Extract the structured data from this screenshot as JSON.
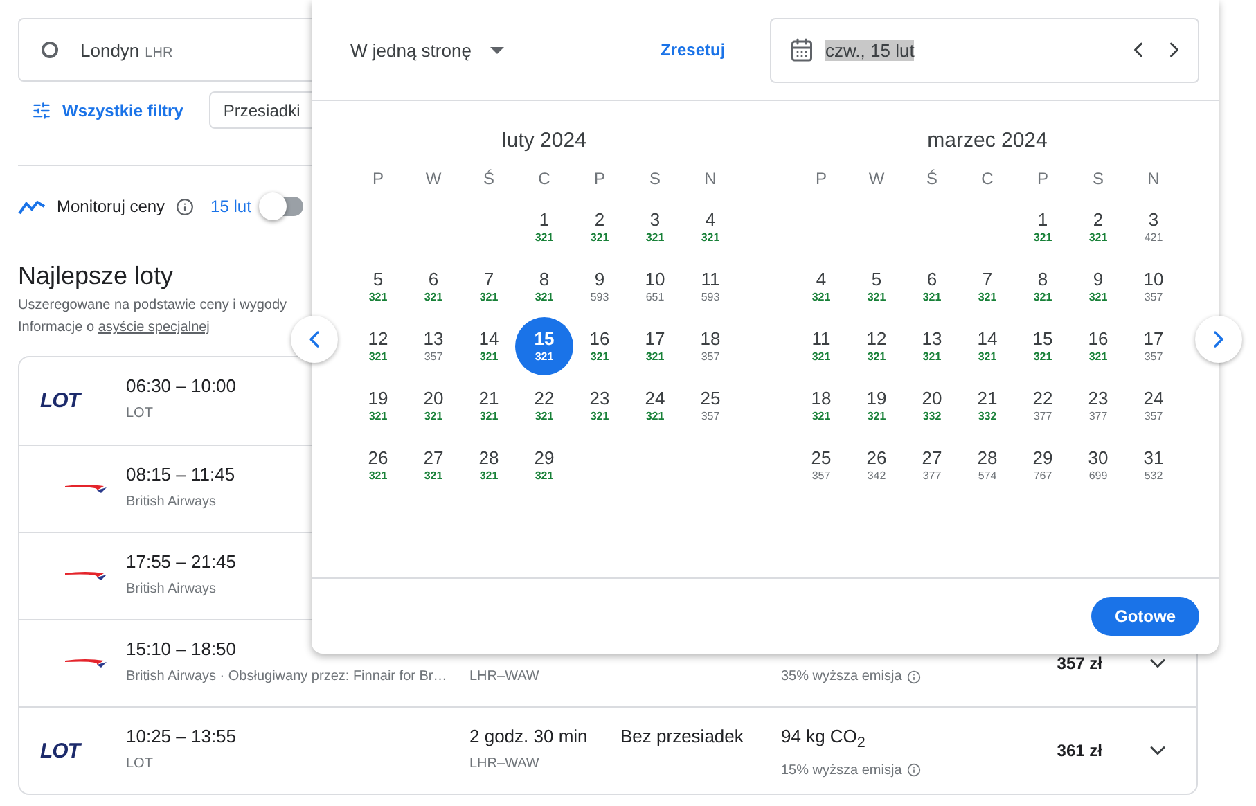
{
  "search": {
    "origin": {
      "city": "Londyn",
      "code": "LHR"
    }
  },
  "filters": {
    "all_filters": "Wszystkie filtry",
    "chips": [
      "Przesiadki"
    ]
  },
  "monitor": {
    "label": "Monitoruj ceny",
    "date": "15 lut",
    "on": false
  },
  "results": {
    "title": "Najlepsze loty",
    "subtitle": "Uszeregowane na podstawie ceny i wygody",
    "assist_prefix": "Informacje o ",
    "assist_link": "asyście specjalnej"
  },
  "flights": [
    {
      "logo": {
        "kind": "wordmark",
        "text": "LOT"
      },
      "times": "06:30 – 10:00",
      "airline": "LOT"
    },
    {
      "logo": {
        "kind": "ribbon"
      },
      "times": "08:15 – 11:45",
      "airline": "British Airways"
    },
    {
      "logo": {
        "kind": "ribbon"
      },
      "times": "17:55 – 21:45",
      "airline": "British Airways"
    },
    {
      "logo": {
        "kind": "ribbon"
      },
      "times": "15:10 – 18:50",
      "airline": "British Airways · Obsługiwany przez: Finnair for Br…",
      "route": "LHR–WAW",
      "emission_note": "35% wyższa emisja",
      "price": "357 zł",
      "expandable": true
    },
    {
      "logo": {
        "kind": "wordmark",
        "text": "LOT"
      },
      "times": "10:25 – 13:55",
      "airline": "LOT",
      "duration": "2 godz. 30 min",
      "route": "LHR–WAW",
      "stops": "Bez przesiadek",
      "emissions": "94 kg CO$_{2}$",
      "emission_note": "15% wyższa emisja",
      "price": "361 zł",
      "expandable": true
    }
  ],
  "date_picker": {
    "trip_type": "W jedną stronę",
    "reset": "Zresetuj",
    "date_value": "czw., 15 lut",
    "done": "Gotowe",
    "months": [
      {
        "title": "luty 2024",
        "weekdays": [
          "P",
          "W",
          "Ś",
          "C",
          "P",
          "S",
          "N"
        ],
        "weeks": [
          [
            {
              "d": "1",
              "price": "321",
              "low": true,
              "selected": false
            },
            {
              "d": "2",
              "price": "321",
              "low": true,
              "selected": false
            },
            {
              "d": "3",
              "price": "321",
              "low": true,
              "selected": false
            },
            {
              "d": "4",
              "price": "321",
              "low": true,
              "selected": false
            }
          ],
          [
            {
              "d": "5",
              "price": "321",
              "low": true,
              "selected": false
            },
            {
              "d": "6",
              "price": "321",
              "low": true,
              "selected": false
            },
            {
              "d": "7",
              "price": "321",
              "low": true,
              "selected": false
            },
            {
              "d": "8",
              "price": "321",
              "low": true,
              "selected": false
            },
            {
              "d": "9",
              "price": "593",
              "low": false,
              "selected": false
            },
            {
              "d": "10",
              "price": "651",
              "low": false,
              "selected": false
            },
            {
              "d": "11",
              "price": "593",
              "low": false,
              "selected": false
            }
          ],
          [
            {
              "d": "12",
              "price": "321",
              "low": true,
              "selected": false
            },
            {
              "d": "13",
              "price": "357",
              "low": false,
              "selected": false
            },
            {
              "d": "14",
              "price": "321",
              "low": true,
              "selected": false
            },
            {
              "d": "15",
              "price": "321",
              "low": true,
              "selected": true
            },
            {
              "d": "16",
              "price": "321",
              "low": true,
              "selected": false
            },
            {
              "d": "17",
              "price": "321",
              "low": true,
              "selected": false
            },
            {
              "d": "18",
              "price": "357",
              "low": false,
              "selected": false
            }
          ],
          [
            {
              "d": "19",
              "price": "321",
              "low": true,
              "selected": false
            },
            {
              "d": "20",
              "price": "321",
              "low": true,
              "selected": false
            },
            {
              "d": "21",
              "price": "321",
              "low": true,
              "selected": false
            },
            {
              "d": "22",
              "price": "321",
              "low": true,
              "selected": false
            },
            {
              "d": "23",
              "price": "321",
              "low": true,
              "selected": false
            },
            {
              "d": "24",
              "price": "321",
              "low": true,
              "selected": false
            },
            {
              "d": "25",
              "price": "357",
              "low": false,
              "selected": false
            }
          ],
          [
            {
              "d": "26",
              "price": "321",
              "low": true,
              "selected": false
            },
            {
              "d": "27",
              "price": "321",
              "low": true,
              "selected": false
            },
            {
              "d": "28",
              "price": "321",
              "low": true,
              "selected": false
            },
            {
              "d": "29",
              "price": "321",
              "low": true,
              "selected": false
            }
          ]
        ]
      },
      {
        "title": "marzec 2024",
        "weekdays": [
          "P",
          "W",
          "Ś",
          "C",
          "P",
          "S",
          "N"
        ],
        "weeks": [
          [
            {
              "d": "1",
              "price": "321",
              "low": true,
              "selected": false
            },
            {
              "d": "2",
              "price": "321",
              "low": true,
              "selected": false
            },
            {
              "d": "3",
              "price": "421",
              "low": false,
              "selected": false
            }
          ],
          [
            {
              "d": "4",
              "price": "321",
              "low": true,
              "selected": false
            },
            {
              "d": "5",
              "price": "321",
              "low": true,
              "selected": false
            },
            {
              "d": "6",
              "price": "321",
              "low": true,
              "selected": false
            },
            {
              "d": "7",
              "price": "321",
              "low": true,
              "selected": false
            },
            {
              "d": "8",
              "price": "321",
              "low": true,
              "selected": false
            },
            {
              "d": "9",
              "price": "321",
              "low": true,
              "selected": false
            },
            {
              "d": "10",
              "price": "357",
              "low": false,
              "selected": false
            }
          ],
          [
            {
              "d": "11",
              "price": "321",
              "low": true,
              "selected": false
            },
            {
              "d": "12",
              "price": "321",
              "low": true,
              "selected": false
            },
            {
              "d": "13",
              "price": "321",
              "low": true,
              "selected": false
            },
            {
              "d": "14",
              "price": "321",
              "low": true,
              "selected": false
            },
            {
              "d": "15",
              "price": "321",
              "low": true,
              "selected": false
            },
            {
              "d": "16",
              "price": "321",
              "low": true,
              "selected": false
            },
            {
              "d": "17",
              "price": "357",
              "low": false,
              "selected": false
            }
          ],
          [
            {
              "d": "18",
              "price": "321",
              "low": true,
              "selected": false
            },
            {
              "d": "19",
              "price": "321",
              "low": true,
              "selected": false
            },
            {
              "d": "20",
              "price": "332",
              "low": true,
              "selected": false
            },
            {
              "d": "21",
              "price": "332",
              "low": true,
              "selected": false
            },
            {
              "d": "22",
              "price": "377",
              "low": false,
              "selected": false
            },
            {
              "d": "23",
              "price": "377",
              "low": false,
              "selected": false
            },
            {
              "d": "24",
              "price": "357",
              "low": false,
              "selected": false
            }
          ],
          [
            {
              "d": "25",
              "price": "357",
              "low": false,
              "selected": false
            },
            {
              "d": "26",
              "price": "342",
              "low": false,
              "selected": false
            },
            {
              "d": "27",
              "price": "377",
              "low": false,
              "selected": false
            },
            {
              "d": "28",
              "price": "574",
              "low": false,
              "selected": false
            },
            {
              "d": "29",
              "price": "767",
              "low": false,
              "selected": false
            },
            {
              "d": "30",
              "price": "699",
              "low": false,
              "selected": false
            },
            {
              "d": "31",
              "price": "532",
              "low": false,
              "selected": false
            }
          ]
        ]
      }
    ]
  }
}
